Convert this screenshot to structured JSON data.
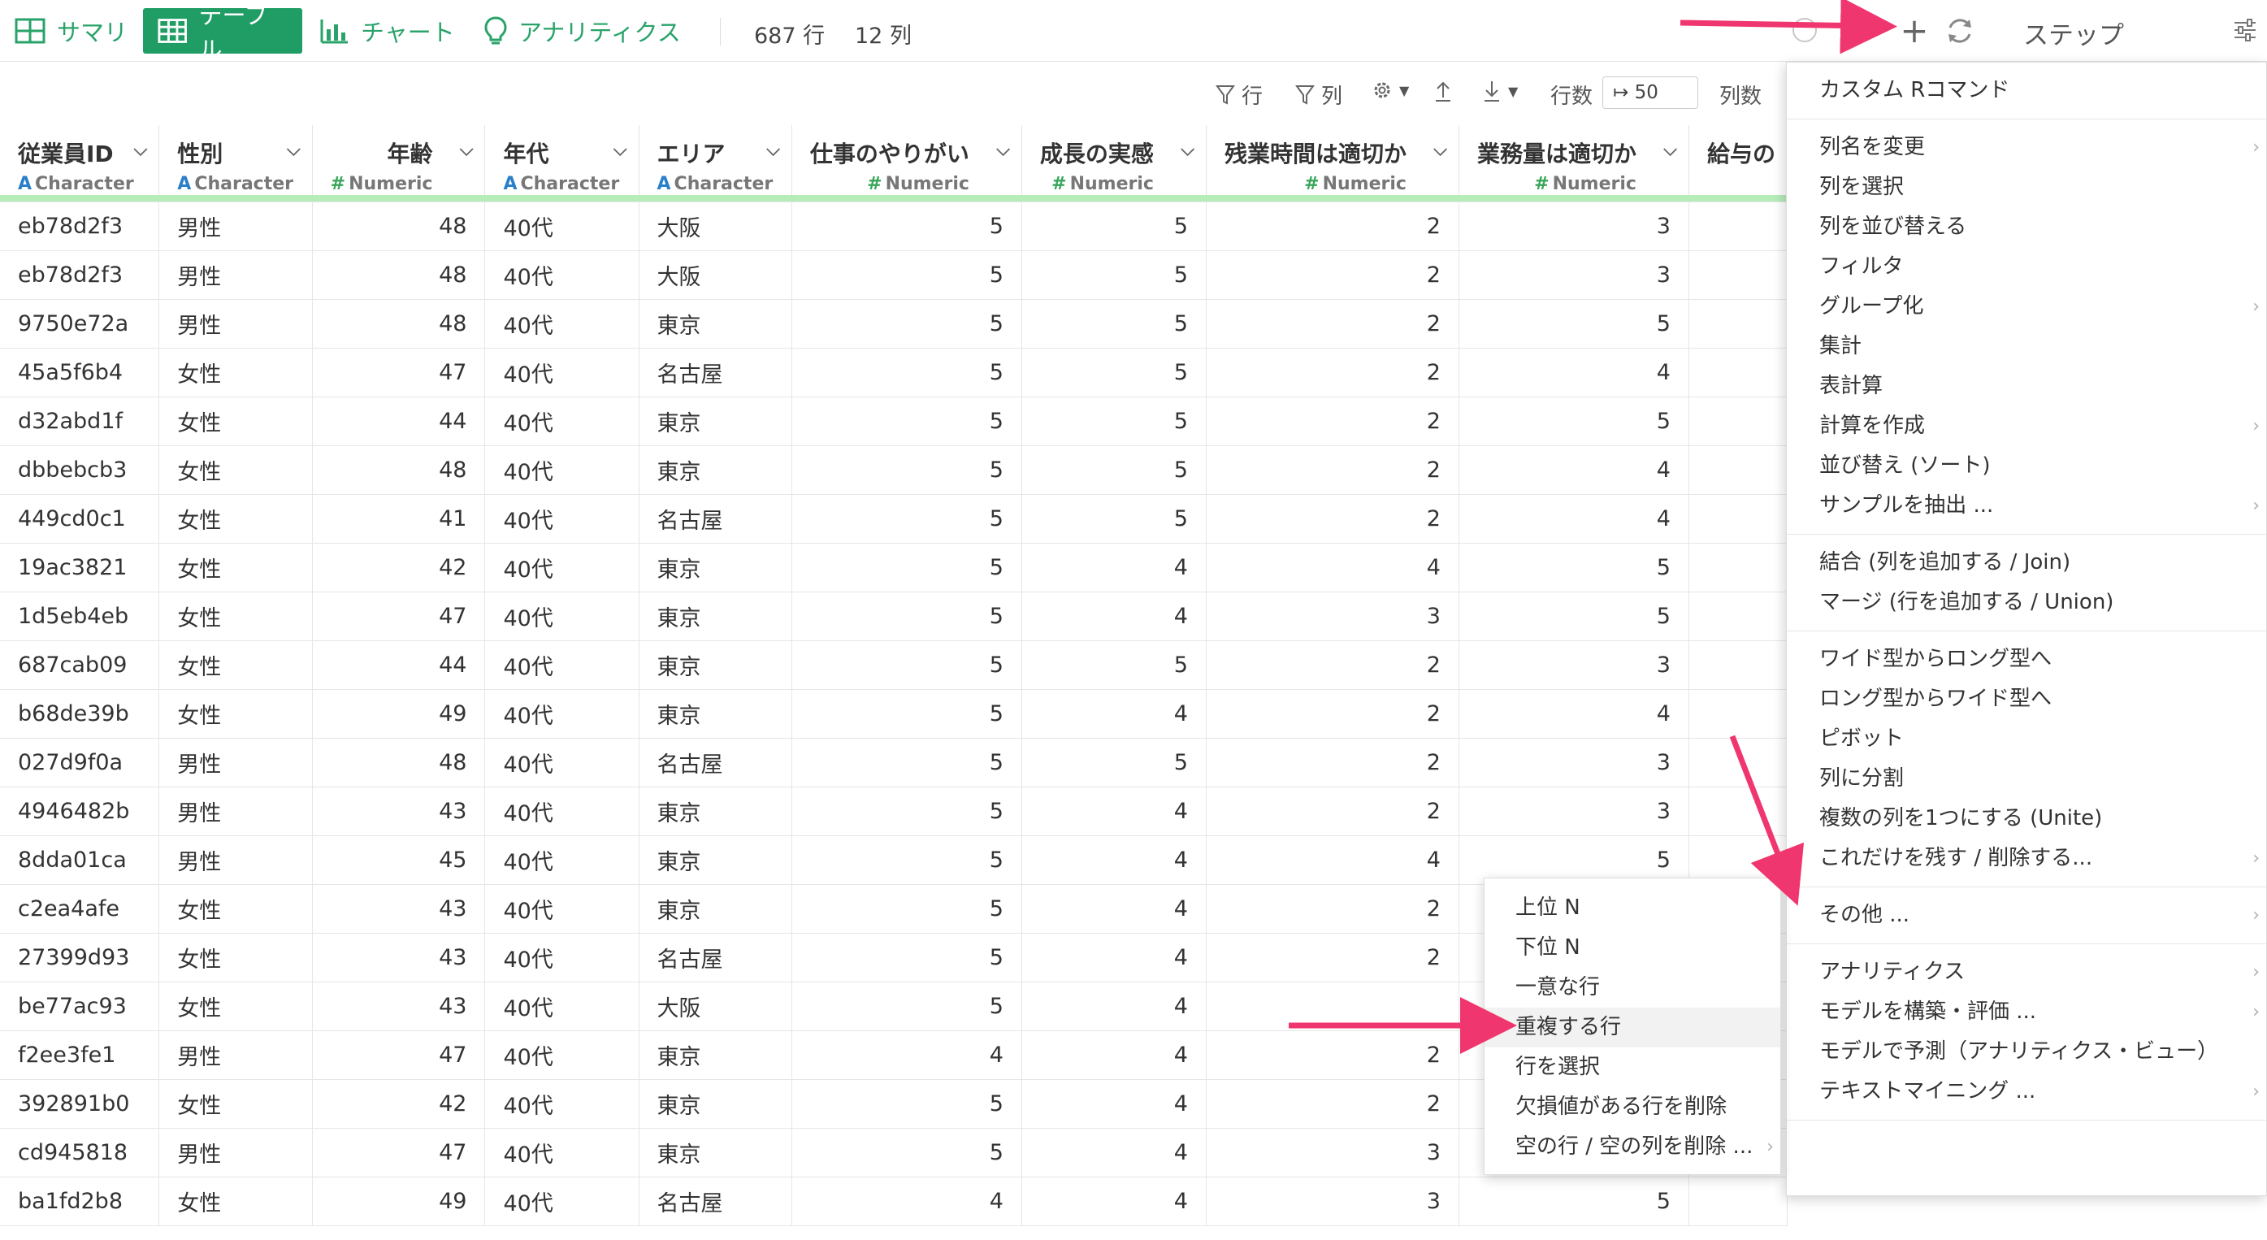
{
  "tabs": [
    {
      "label": "サマリ",
      "icon": "summary-grid-icon"
    },
    {
      "label": "テーブル",
      "icon": "table-icon",
      "active": true
    },
    {
      "label": "チャート",
      "icon": "bar-chart-icon"
    },
    {
      "label": "アナリティクス",
      "icon": "lightbulb-icon"
    }
  ],
  "counts": {
    "rows": "687 行",
    "cols": "12 列"
  },
  "steps_panel": {
    "title": "ステップ",
    "add_icon": "+"
  },
  "toolbar": {
    "filter_rows": "行",
    "filter_cols": "列",
    "rows_label": "行数",
    "rows_value": "↦ 50",
    "cols_label": "列数"
  },
  "columns": [
    {
      "name": "従業員ID",
      "type": "Character"
    },
    {
      "name": "性別",
      "type": "Character"
    },
    {
      "name": "年齢",
      "type": "Numeric"
    },
    {
      "name": "年代",
      "type": "Character"
    },
    {
      "name": "エリア",
      "type": "Character"
    },
    {
      "name": "仕事のやりがい",
      "type": "Numeric"
    },
    {
      "name": "成長の実感",
      "type": "Numeric"
    },
    {
      "name": "残業時間は適切か",
      "type": "Numeric"
    },
    {
      "name": "業務量は適切か",
      "type": "Numeric"
    },
    {
      "name": "給与の",
      "type": ""
    }
  ],
  "rows": [
    [
      "eb78d2f3",
      "男性",
      "48",
      "40代",
      "大阪",
      "5",
      "5",
      "2",
      "3"
    ],
    [
      "eb78d2f3",
      "男性",
      "48",
      "40代",
      "大阪",
      "5",
      "5",
      "2",
      "3"
    ],
    [
      "9750e72a",
      "男性",
      "48",
      "40代",
      "東京",
      "5",
      "5",
      "2",
      "5"
    ],
    [
      "45a5f6b4",
      "女性",
      "47",
      "40代",
      "名古屋",
      "5",
      "5",
      "2",
      "4"
    ],
    [
      "d32abd1f",
      "女性",
      "44",
      "40代",
      "東京",
      "5",
      "5",
      "2",
      "5"
    ],
    [
      "dbbebcb3",
      "女性",
      "48",
      "40代",
      "東京",
      "5",
      "5",
      "2",
      "4"
    ],
    [
      "449cd0c1",
      "女性",
      "41",
      "40代",
      "名古屋",
      "5",
      "5",
      "2",
      "4"
    ],
    [
      "19ac3821",
      "女性",
      "42",
      "40代",
      "東京",
      "5",
      "4",
      "4",
      "5"
    ],
    [
      "1d5eb4eb",
      "女性",
      "47",
      "40代",
      "東京",
      "5",
      "4",
      "3",
      "5"
    ],
    [
      "687cab09",
      "女性",
      "44",
      "40代",
      "東京",
      "5",
      "5",
      "2",
      "3"
    ],
    [
      "b68de39b",
      "女性",
      "49",
      "40代",
      "東京",
      "5",
      "4",
      "2",
      "4"
    ],
    [
      "027d9f0a",
      "男性",
      "48",
      "40代",
      "名古屋",
      "5",
      "5",
      "2",
      "3"
    ],
    [
      "4946482b",
      "男性",
      "43",
      "40代",
      "東京",
      "5",
      "4",
      "2",
      "3"
    ],
    [
      "8dda01ca",
      "男性",
      "45",
      "40代",
      "東京",
      "5",
      "4",
      "4",
      "5"
    ],
    [
      "c2ea4afe",
      "女性",
      "43",
      "40代",
      "東京",
      "5",
      "4",
      "2",
      ""
    ],
    [
      "27399d93",
      "女性",
      "43",
      "40代",
      "名古屋",
      "5",
      "4",
      "2",
      ""
    ],
    [
      "be77ac93",
      "女性",
      "43",
      "40代",
      "大阪",
      "5",
      "4",
      "",
      ""
    ],
    [
      "f2ee3fe1",
      "男性",
      "47",
      "40代",
      "東京",
      "4",
      "4",
      "2",
      ""
    ],
    [
      "392891b0",
      "女性",
      "42",
      "40代",
      "東京",
      "5",
      "4",
      "2",
      ""
    ],
    [
      "cd945818",
      "男性",
      "47",
      "40代",
      "東京",
      "5",
      "4",
      "3",
      ""
    ],
    [
      "ba1fd2b8",
      "女性",
      "49",
      "40代",
      "名古屋",
      "4",
      "4",
      "3",
      "5"
    ]
  ],
  "step_menu": [
    [
      {
        "label": "カスタム Rコマンド"
      }
    ],
    [
      {
        "label": "列名を変更",
        "sub": true
      },
      {
        "label": "列を選択"
      },
      {
        "label": "列を並び替える"
      },
      {
        "label": "フィルタ"
      },
      {
        "label": "グループ化",
        "sub": true
      },
      {
        "label": "集計"
      },
      {
        "label": "表計算"
      },
      {
        "label": "計算を作成",
        "sub": true
      },
      {
        "label": "並び替え (ソート)"
      },
      {
        "label": "サンプルを抽出 ...",
        "sub": true
      }
    ],
    [
      {
        "label": "結合 (列を追加する / Join)"
      },
      {
        "label": "マージ (行を追加する / Union)"
      }
    ],
    [
      {
        "label": "ワイド型からロング型へ"
      },
      {
        "label": "ロング型からワイド型へ"
      },
      {
        "label": "ピボット"
      },
      {
        "label": "列に分割"
      },
      {
        "label": "複数の列を1つにする (Unite)"
      },
      {
        "label": "これだけを残す / 削除する...",
        "sub": true
      }
    ],
    [
      {
        "label": "その他 ...",
        "sub": true
      }
    ],
    [
      {
        "label": "アナリティクス",
        "sub": true
      },
      {
        "label": "モデルを構築・評価 ...",
        "sub": true
      },
      {
        "label": "モデルで予測（アナリティクス・ビュー）"
      },
      {
        "label": "テキストマイニング ...",
        "sub": true
      }
    ]
  ],
  "sub_menu": [
    {
      "label": "上位 N"
    },
    {
      "label": "下位 N"
    },
    {
      "label": "一意な行"
    },
    {
      "label": "重複する行",
      "highlight": true
    },
    {
      "label": "行を選択"
    },
    {
      "label": "欠損値がある行を削除"
    },
    {
      "label": "空の行 / 空の列を削除 ...",
      "sub": true
    }
  ],
  "colors": {
    "accent_green": "#1f9d64",
    "arrow": "#f0366e",
    "column_bar": "#b6ecb8"
  }
}
